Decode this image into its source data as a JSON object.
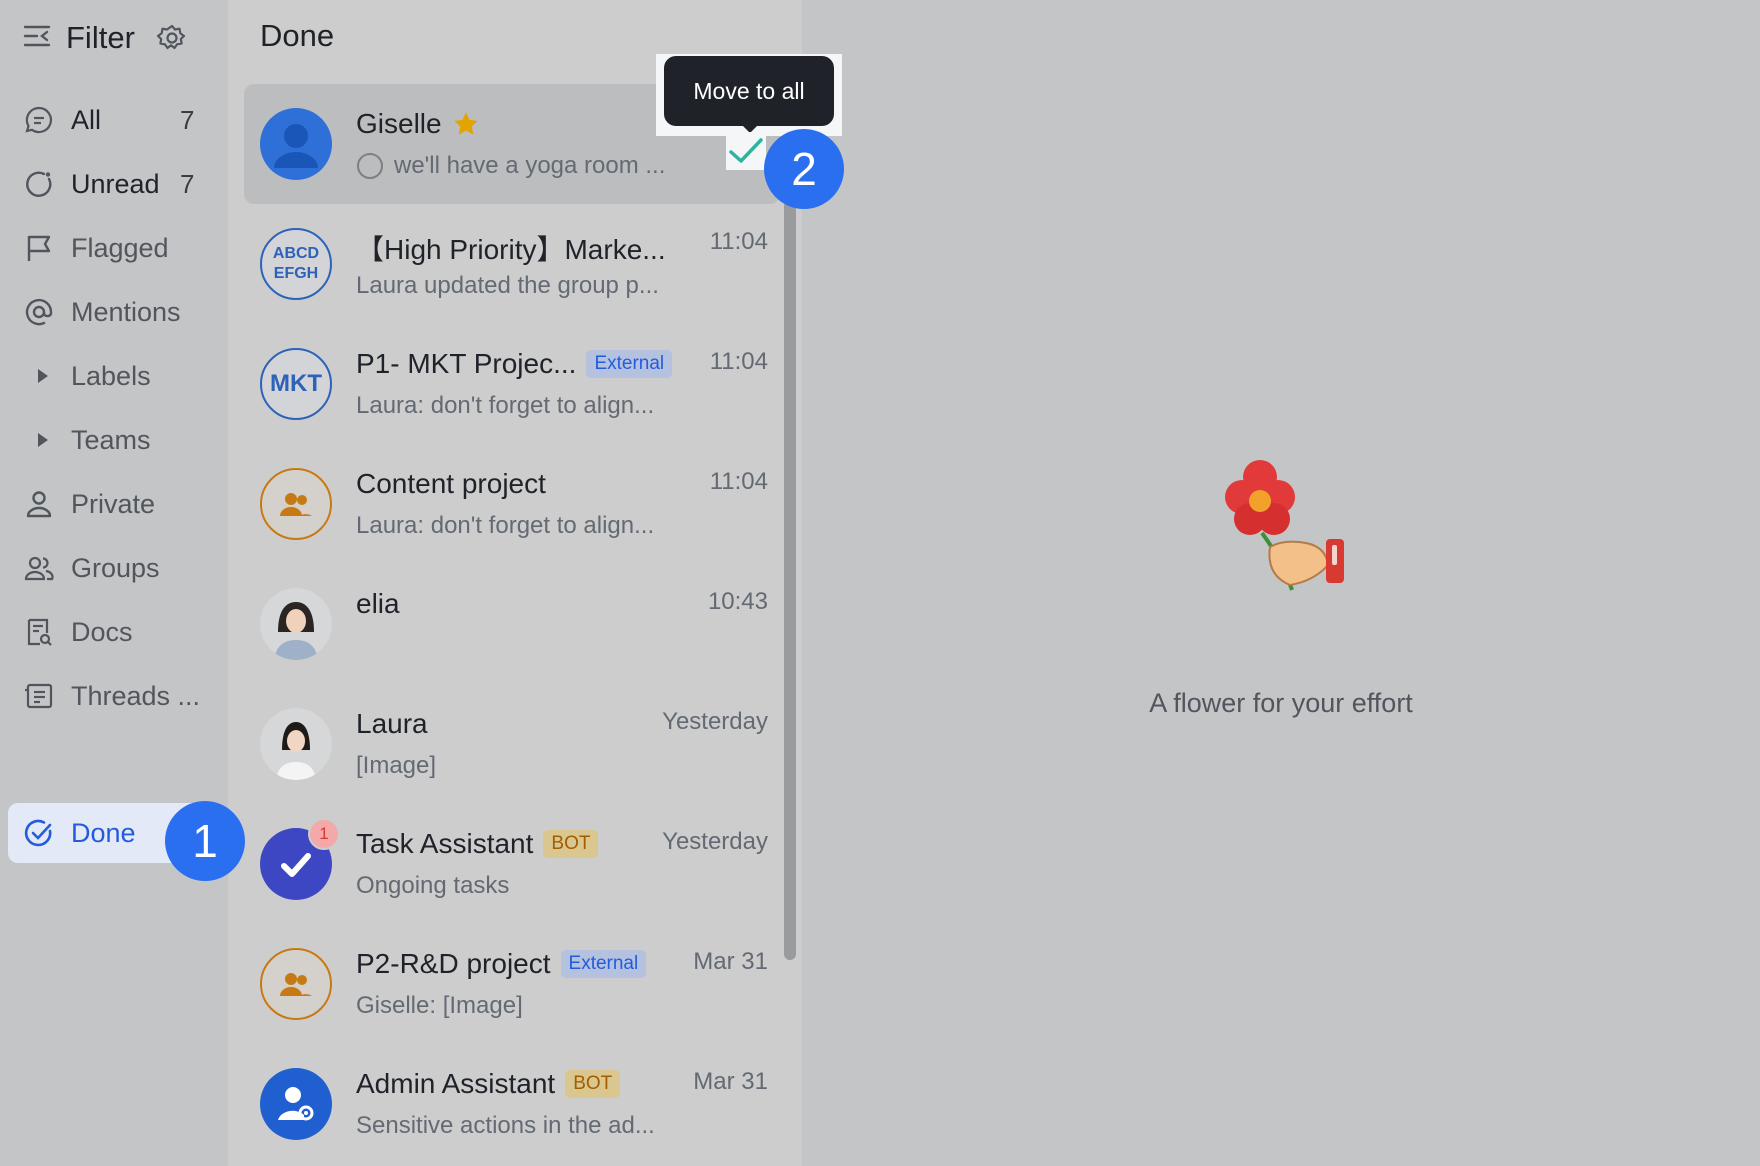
{
  "sidebar": {
    "title": "Filter",
    "items": [
      {
        "label": "All",
        "count": "7"
      },
      {
        "label": "Unread",
        "count": "7"
      },
      {
        "label": "Flagged"
      },
      {
        "label": "Mentions"
      },
      {
        "label": "Labels"
      },
      {
        "label": "Teams"
      },
      {
        "label": "Private"
      },
      {
        "label": "Groups"
      },
      {
        "label": "Docs"
      },
      {
        "label": "Threads ..."
      },
      {
        "label": "Done"
      }
    ]
  },
  "list": {
    "title": "Done",
    "chats": [
      {
        "name": "Giselle",
        "preview": "we'll have a yoga room ...",
        "time": ""
      },
      {
        "name": "【High Priority】Marke...",
        "preview": "Laura updated the group p...",
        "time": "11:04",
        "avatar_text": "ABCD EFGH"
      },
      {
        "name": "P1- MKT Projec...",
        "tag": "External",
        "preview": "Laura: don't forget to align...",
        "time": "11:04",
        "avatar_text": "MKT"
      },
      {
        "name": "Content project",
        "preview": "Laura: don't forget to align...",
        "time": "11:04"
      },
      {
        "name": "elia",
        "preview": "",
        "time": "10:43"
      },
      {
        "name": "Laura",
        "preview": "[Image]",
        "time": "Yesterday"
      },
      {
        "name": "Task Assistant",
        "tag": "BOT",
        "preview": "Ongoing tasks",
        "time": "Yesterday",
        "badge": "1"
      },
      {
        "name": "P2-R&D project",
        "tag": "External",
        "preview": "Giselle: [Image]",
        "time": "Mar 31"
      },
      {
        "name": "Admin Assistant",
        "tag": "BOT",
        "preview": "Sensitive actions in the ad...",
        "time": "Mar 31"
      }
    ]
  },
  "tooltip": {
    "text": "Move to all"
  },
  "callouts": [
    "1",
    "2"
  ],
  "empty_state": {
    "text": "A flower for your effort"
  },
  "colors": {
    "accent": "#245bdb",
    "callout": "#2a6ff0",
    "check": "#2bb5a0"
  }
}
